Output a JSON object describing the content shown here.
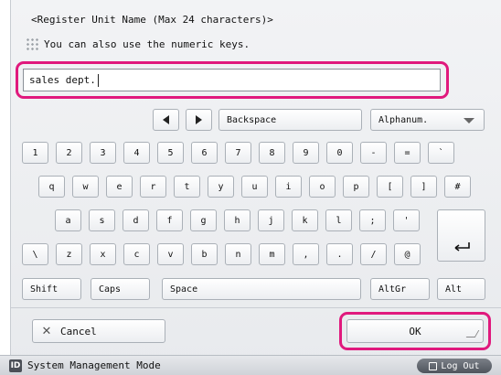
{
  "dialog": {
    "title": "<Register Unit Name (Max 24 characters)>",
    "hint": "You can also use the numeric keys.",
    "input_value": "sales dept."
  },
  "nav": {
    "backspace_label": "Backspace",
    "mode_selected": "Alphanum."
  },
  "keys": {
    "row1": [
      "1",
      "2",
      "3",
      "4",
      "5",
      "6",
      "7",
      "8",
      "9",
      "0",
      "-",
      "=",
      "`"
    ],
    "row2": [
      "q",
      "w",
      "e",
      "r",
      "t",
      "y",
      "u",
      "i",
      "o",
      "p",
      "[",
      "]",
      "#"
    ],
    "row3": [
      "a",
      "s",
      "d",
      "f",
      "g",
      "h",
      "j",
      "k",
      "l",
      ";",
      "'"
    ],
    "row4": [
      "\\",
      "z",
      "x",
      "c",
      "v",
      "b",
      "n",
      "m",
      ",",
      ".",
      "/",
      "@"
    ],
    "shift": "Shift",
    "caps": "Caps",
    "space": "Space",
    "altgr": "AltGr",
    "alt": "Alt"
  },
  "actions": {
    "cancel": "Cancel",
    "ok": "OK"
  },
  "status": {
    "mode_icon": "ID",
    "mode": "System Management Mode",
    "logout": "Log Out"
  },
  "colors": {
    "highlight": "#e0197d"
  }
}
